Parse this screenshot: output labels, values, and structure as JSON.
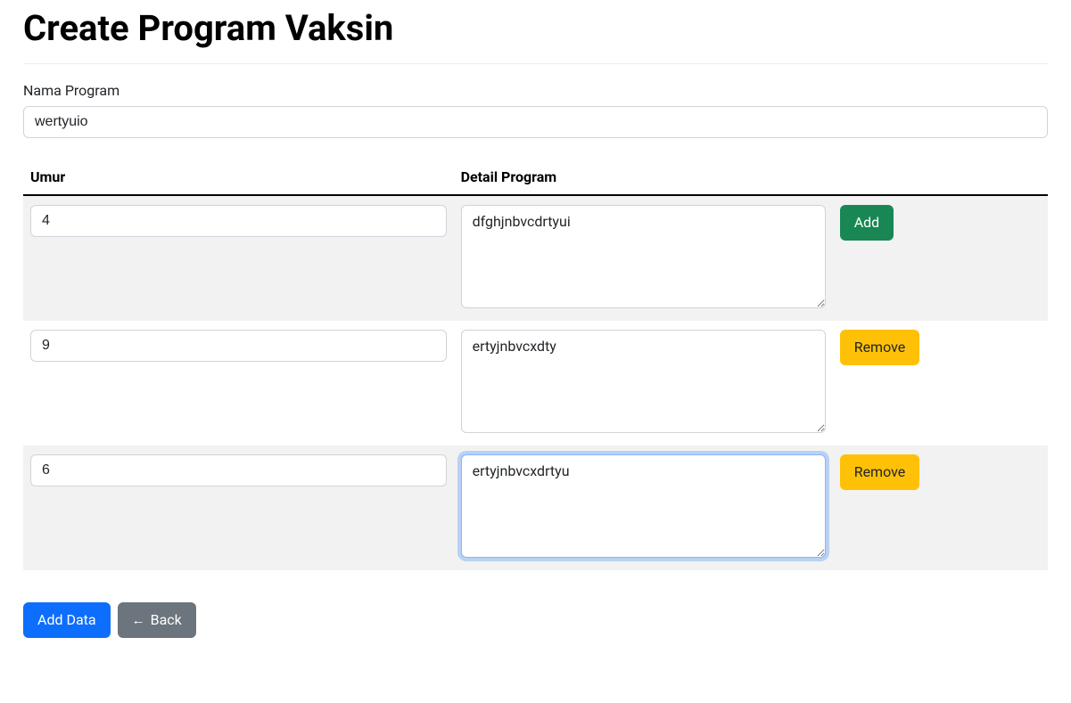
{
  "page": {
    "title": "Create Program Vaksin"
  },
  "form": {
    "nama_program": {
      "label": "Nama Program",
      "value": "wertyuio"
    }
  },
  "table": {
    "headers": {
      "umur": "Umur",
      "detail": "Detail Program"
    },
    "rows": [
      {
        "umur": "4",
        "detail": "dfghjnbvcdrtyui",
        "action_label": "Add",
        "action_type": "add"
      },
      {
        "umur": "9",
        "detail": "ertyjnbvcxdty",
        "action_label": "Remove",
        "action_type": "remove"
      },
      {
        "umur": "6",
        "detail": "ertyjnbvcxdrtyu",
        "action_label": "Remove",
        "action_type": "remove",
        "focused": true
      }
    ]
  },
  "footer": {
    "add_data_label": "Add Data",
    "back_label": "Back",
    "back_arrow": "←"
  }
}
